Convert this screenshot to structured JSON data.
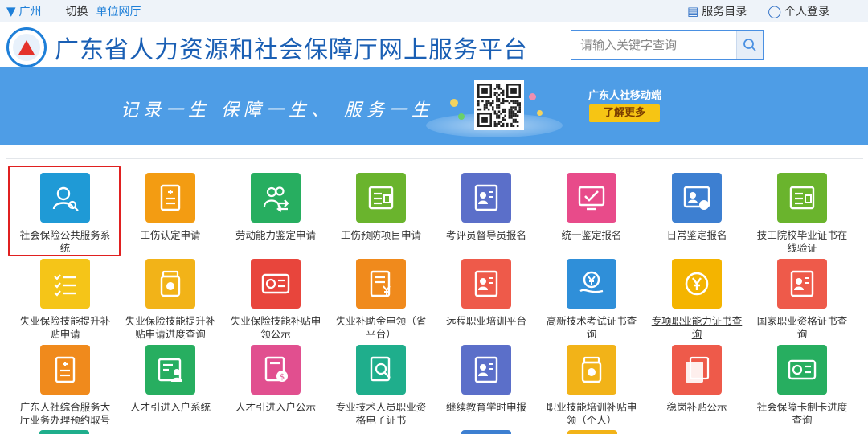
{
  "topbar": {
    "city": "广州",
    "switch_label": "切换",
    "unit_hall": "单位网厅",
    "service_catalog": "服务目录",
    "personal_login": "个人登录"
  },
  "header": {
    "site_title": "广东省人力资源和社会保障厅网上服务平台",
    "search_placeholder": "请输入关键字查询"
  },
  "banner": {
    "slogan": "记录一生  保障一生、 服务一生",
    "mobile_label": "广东人社移动端",
    "learn_more": "了解更多"
  },
  "services": [
    {
      "label": "社会保险公共服务系统",
      "color": "#1f9ad6",
      "icon": "user-search-icon",
      "selected": true
    },
    {
      "label": "工伤认定申请",
      "color": "#f39c12",
      "icon": "document-plus-icon"
    },
    {
      "label": "劳动能力鉴定申请",
      "color": "#27ae60",
      "icon": "users-exchange-icon"
    },
    {
      "label": "工伤预防项目申请",
      "color": "#6ab42d",
      "icon": "form-icon"
    },
    {
      "label": "考评员督导员报名",
      "color": "#5b6fc9",
      "icon": "id-card-icon"
    },
    {
      "label": "统一鉴定报名",
      "color": "#e84b8a",
      "icon": "screen-check-icon"
    },
    {
      "label": "日常鉴定报名",
      "color": "#3d7fd1",
      "icon": "certificate-icon"
    },
    {
      "label": "技工院校毕业证书在线验证",
      "color": "#6ab42d",
      "icon": "form-icon"
    },
    {
      "label": "失业保险技能提升补贴申请",
      "color": "#f5c518",
      "icon": "checklist-icon"
    },
    {
      "label": "失业保险技能提升补贴申请进度查询",
      "color": "#f2b318",
      "icon": "pill-bottle-icon"
    },
    {
      "label": "失业保险技能补贴申领公示",
      "color": "#e8453c",
      "icon": "card-icon"
    },
    {
      "label": "失业补助金申领（省平台）",
      "color": "#f08a1c",
      "icon": "document-yen-icon"
    },
    {
      "label": "远程职业培训平台",
      "color": "#ee5a4a",
      "icon": "id-card-icon"
    },
    {
      "label": "高新技术考试证书查询",
      "color": "#2f8fd9",
      "icon": "yen-hand-icon"
    },
    {
      "label": "专项职业能力证书查询",
      "color": "#f4b400",
      "icon": "yen-coin-icon",
      "underline": true
    },
    {
      "label": "国家职业资格证书查询",
      "color": "#ee5a4a",
      "icon": "id-card-icon"
    },
    {
      "label": "广东人社综合服务大厅业务办理预约取号",
      "color": "#f08a1c",
      "icon": "document-plus-icon"
    },
    {
      "label": "人才引进入户系统",
      "color": "#27ae60",
      "icon": "form-user-icon"
    },
    {
      "label": "人才引进入户公示",
      "color": "#e14f8f",
      "icon": "document-dollar-icon"
    },
    {
      "label": "专业技术人员职业资格电子证书",
      "color": "#1fae8c",
      "icon": "document-search-icon"
    },
    {
      "label": "继续教育学时申报",
      "color": "#5b6fc9",
      "icon": "id-card-icon"
    },
    {
      "label": "职业技能培训补贴申领（个人）",
      "color": "#f2b318",
      "icon": "pill-bottle-icon"
    },
    {
      "label": "稳岗补贴公示",
      "color": "#ee5a4a",
      "icon": "document-stack-icon"
    },
    {
      "label": "社会保障卡制卡进度查询",
      "color": "#27ae60",
      "icon": "card-icon"
    }
  ]
}
